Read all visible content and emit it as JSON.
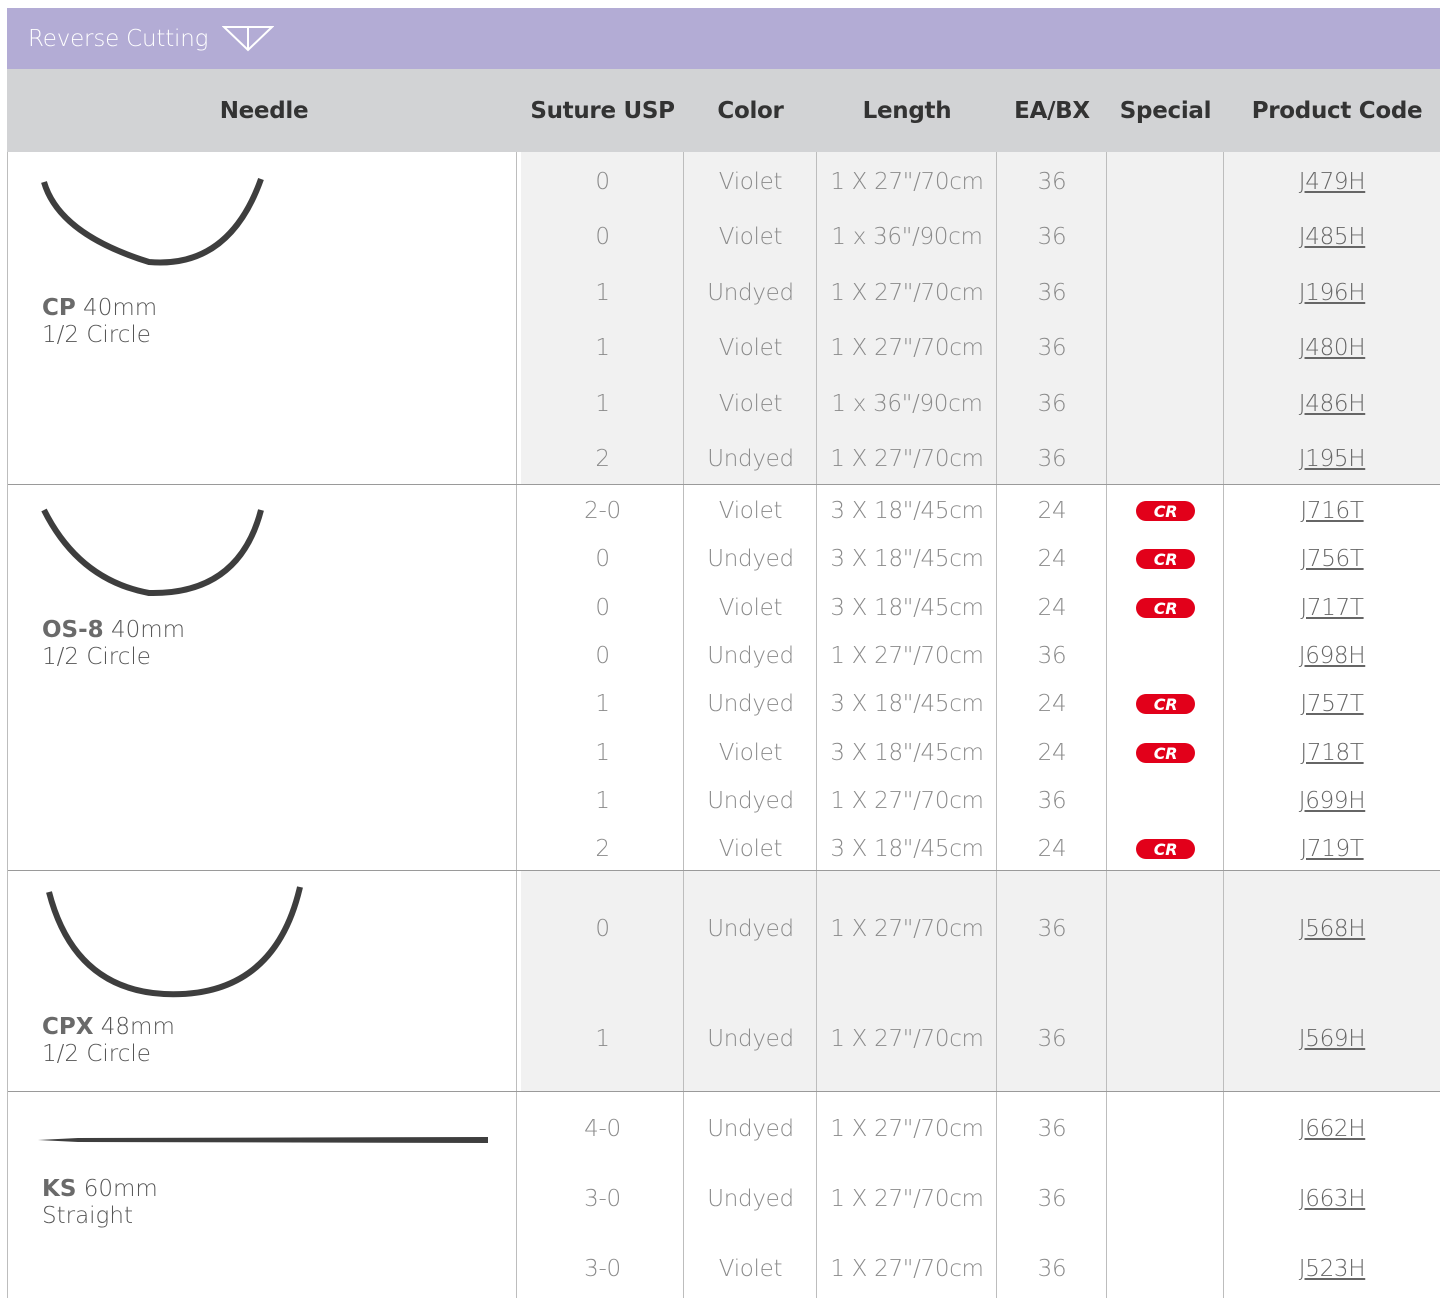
{
  "section_title": "Reverse Cutting",
  "columns": [
    "Needle",
    "Suture USP",
    "Color",
    "Length",
    "EA/BX",
    "Special",
    "Product Code"
  ],
  "groups": [
    {
      "needle": {
        "code": "CP",
        "size": "40mm",
        "shape": "1/2 Circle",
        "image": "curved-needle-icon"
      },
      "rows": [
        {
          "usp": "0",
          "color": "Violet",
          "length": "1 X 27\"/70cm",
          "eabx": "36",
          "special": "",
          "code": "J479H"
        },
        {
          "usp": "0",
          "color": "Violet",
          "length": "1 x 36\"/90cm",
          "eabx": "36",
          "special": "",
          "code": "J485H"
        },
        {
          "usp": "1",
          "color": "Undyed",
          "length": "1 X 27\"/70cm",
          "eabx": "36",
          "special": "",
          "code": "J196H"
        },
        {
          "usp": "1",
          "color": "Violet",
          "length": "1 X 27\"/70cm",
          "eabx": "36",
          "special": "",
          "code": "J480H"
        },
        {
          "usp": "1",
          "color": "Violet",
          "length": "1 x 36\"/90cm",
          "eabx": "36",
          "special": "",
          "code": "J486H"
        },
        {
          "usp": "2",
          "color": "Undyed",
          "length": "1 X 27\"/70cm",
          "eabx": "36",
          "special": "",
          "code": "J195H"
        }
      ]
    },
    {
      "needle": {
        "code": "OS-8",
        "size": "40mm",
        "shape": "1/2 Circle",
        "image": "curved-needle-icon"
      },
      "rows": [
        {
          "usp": "2-0",
          "color": "Violet",
          "length": "3 X 18\"/45cm",
          "eabx": "24",
          "special": "CR",
          "code": "J716T"
        },
        {
          "usp": "0",
          "color": "Undyed",
          "length": "3 X 18\"/45cm",
          "eabx": "24",
          "special": "CR",
          "code": "J756T"
        },
        {
          "usp": "0",
          "color": "Violet",
          "length": "3 X 18\"/45cm",
          "eabx": "24",
          "special": "CR",
          "code": "J717T"
        },
        {
          "usp": "0",
          "color": "Undyed",
          "length": "1 X 27\"/70cm",
          "eabx": "36",
          "special": "",
          "code": "J698H"
        },
        {
          "usp": "1",
          "color": "Undyed",
          "length": "3 X 18\"/45cm",
          "eabx": "24",
          "special": "CR",
          "code": "J757T"
        },
        {
          "usp": "1",
          "color": "Violet",
          "length": "3 X 18\"/45cm",
          "eabx": "24",
          "special": "CR",
          "code": "J718T"
        },
        {
          "usp": "1",
          "color": "Undyed",
          "length": "1 X 27\"/70cm",
          "eabx": "36",
          "special": "",
          "code": "J699H"
        },
        {
          "usp": "2",
          "color": "Violet",
          "length": "3 X 18\"/45cm",
          "eabx": "24",
          "special": "CR",
          "code": "J719T"
        }
      ]
    },
    {
      "needle": {
        "code": "CPX",
        "size": "48mm",
        "shape": "1/2 Circle",
        "image": "curved-needle-icon"
      },
      "rows": [
        {
          "usp": "0",
          "color": "Undyed",
          "length": "1 X 27\"/70cm",
          "eabx": "36",
          "special": "",
          "code": "J568H"
        },
        {
          "usp": "1",
          "color": "Undyed",
          "length": "1 X 27\"/70cm",
          "eabx": "36",
          "special": "",
          "code": "J569H"
        }
      ]
    },
    {
      "needle": {
        "code": "KS",
        "size": "60mm",
        "shape": "Straight",
        "image": "straight-needle-icon"
      },
      "rows": [
        {
          "usp": "4-0",
          "color": "Undyed",
          "length": "1 X 27\"/70cm",
          "eabx": "36",
          "special": "",
          "code": "J662H"
        },
        {
          "usp": "3-0",
          "color": "Undyed",
          "length": "1 X 27\"/70cm",
          "eabx": "36",
          "special": "",
          "code": "J663H"
        },
        {
          "usp": "3-0",
          "color": "Violet",
          "length": "1 X 27\"/70cm",
          "eabx": "36",
          "special": "",
          "code": "J523H"
        }
      ]
    }
  ],
  "colors": {
    "title_bar": "#b3acd5",
    "header": "#d2d3d5",
    "cr_badge": "#e2001a",
    "shaded_row": "#f1f1f1"
  },
  "icons": {
    "title": "down-triangle-icon"
  }
}
